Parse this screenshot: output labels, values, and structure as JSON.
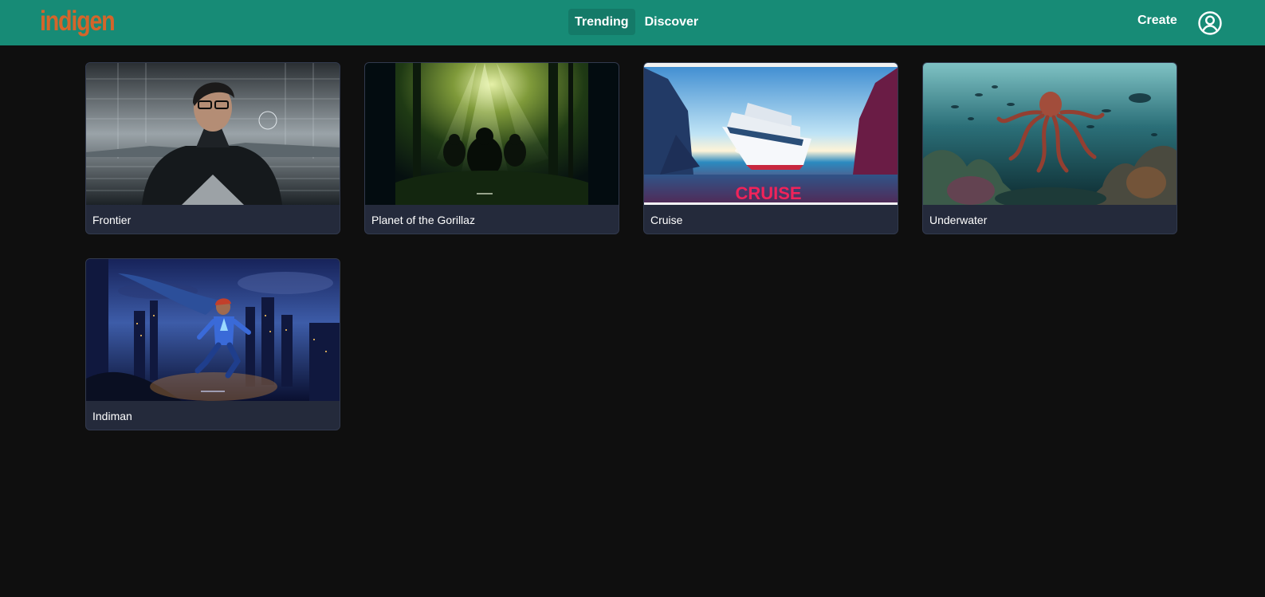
{
  "app": {
    "logo": "indigen"
  },
  "nav": {
    "tabs": [
      {
        "label": "Trending",
        "active": true
      },
      {
        "label": "Discover",
        "active": false
      }
    ],
    "create_label": "Create"
  },
  "icons": {
    "account": "user-circle-icon"
  },
  "colors": {
    "header": "#178b76",
    "logo": "#d4652a",
    "background": "#0f0f0f",
    "card": "#242a3b"
  },
  "cards": [
    {
      "title": "Frontier"
    },
    {
      "title": "Planet of the Gorillaz"
    },
    {
      "title": "Cruise",
      "poster_text": "CRUISE"
    },
    {
      "title": "Underwater"
    },
    {
      "title": "Indiman"
    }
  ]
}
